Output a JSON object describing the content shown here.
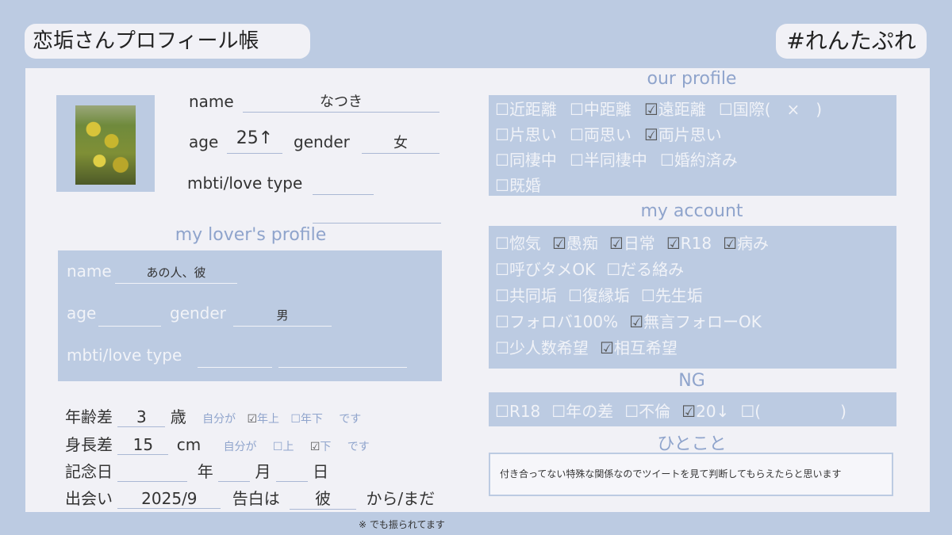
{
  "header": {
    "title": "恋垢さんプロフィール帳",
    "hashtag": "#れんたぷれ"
  },
  "my_profile": {
    "name_label": "name",
    "name_value": "なつき",
    "age_label": "age",
    "age_value": "25↑",
    "gender_label": "gender",
    "gender_value": "女",
    "mbti_label": "mbti/love type"
  },
  "lover_profile": {
    "title": "my lover's profile",
    "name_label": "name",
    "name_value": "あの人、彼",
    "age_label": "age",
    "gender_label": "gender",
    "gender_value": "男",
    "mbti_label": "mbti/love type"
  },
  "age_diff": {
    "label": "年齢差",
    "value": "3",
    "unit": "歳",
    "prefix": "自分が",
    "opt1": "年上",
    "opt2": "年下",
    "suffix": "です"
  },
  "height_diff": {
    "label": "身長差",
    "value": "15",
    "unit": "cm",
    "prefix": "自分が",
    "opt1": "上",
    "opt2": "下",
    "suffix": "です"
  },
  "anniversary": {
    "label": "記念日",
    "year": "年",
    "month": "月",
    "day": "日"
  },
  "meeting": {
    "label": "出会い",
    "value": "2025/9",
    "confess_label": "告白は",
    "confess_value": "彼",
    "confess_suffix": "から/まだ"
  },
  "footnote": "※ でも振られてます",
  "our_profile": {
    "title": "our profile",
    "rows": [
      [
        {
          "label": "近距離",
          "checked": false
        },
        {
          "label": "中距離",
          "checked": false
        },
        {
          "label": "遠距離",
          "checked": true
        },
        {
          "label": "国際(　×　)",
          "checked": false
        }
      ],
      [
        {
          "label": "片思い",
          "checked": false
        },
        {
          "label": "両思い",
          "checked": false
        },
        {
          "label": "両片思い",
          "checked": true
        }
      ],
      [
        {
          "label": "同棲中",
          "checked": false
        },
        {
          "label": "半同棲中",
          "checked": false
        },
        {
          "label": "婚約済み",
          "checked": false
        }
      ],
      [
        {
          "label": "既婚",
          "checked": false
        }
      ]
    ]
  },
  "my_account": {
    "title": "my account",
    "rows": [
      [
        {
          "label": "惚気",
          "checked": false
        },
        {
          "label": "愚痴",
          "checked": true
        },
        {
          "label": "日常",
          "checked": true
        },
        {
          "label": "R18",
          "checked": true
        },
        {
          "label": "病み",
          "checked": true
        }
      ],
      [
        {
          "label": "呼びタメOK",
          "checked": false
        },
        {
          "label": "だる絡み",
          "checked": false
        }
      ],
      [
        {
          "label": "共同垢",
          "checked": false
        },
        {
          "label": "復縁垢",
          "checked": false
        },
        {
          "label": "先生垢",
          "checked": false
        }
      ],
      [
        {
          "label": "フォロバ100%",
          "checked": false
        },
        {
          "label": "無言フォローOK",
          "checked": true
        }
      ],
      [
        {
          "label": "少人数希望",
          "checked": false
        },
        {
          "label": "相互希望",
          "checked": true
        }
      ]
    ]
  },
  "ng": {
    "title": "NG",
    "items": [
      {
        "label": "R18",
        "checked": false
      },
      {
        "label": "年の差",
        "checked": false
      },
      {
        "label": "不倫",
        "checked": false
      },
      {
        "label": "20↓",
        "checked": true
      },
      {
        "label": "(　　　　　)",
        "checked": false
      }
    ]
  },
  "comment": {
    "title": "ひとこと",
    "text": "付き合ってない特殊な関係なのでツイートを見て判断してもらえたらと思います"
  },
  "icons": {
    "unchecked": "☐",
    "checked": "☑"
  },
  "colors": {
    "background": "#bccbe2",
    "card": "#f1f1f6",
    "accent_text": "#8fa4cc"
  }
}
